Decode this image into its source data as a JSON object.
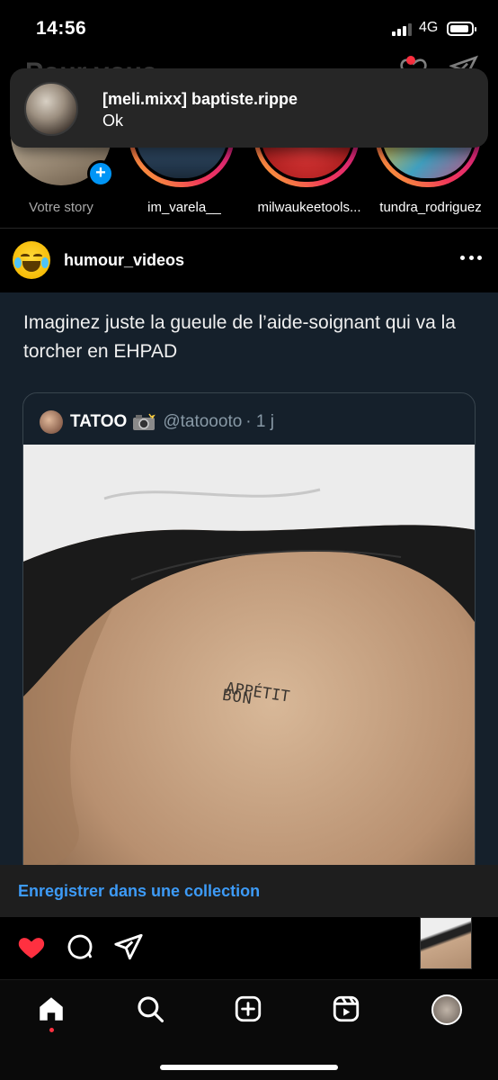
{
  "status": {
    "time": "14:56",
    "network": "4G"
  },
  "header": {
    "feed_title": "Pour vous"
  },
  "notification": {
    "title": "[meli.mixx] baptiste.rippe",
    "body": "Ok"
  },
  "stories": [
    {
      "label": "Votre story"
    },
    {
      "label": "im_varela__"
    },
    {
      "label": "milwaukeetools..."
    },
    {
      "label": "tundra_rodriguez"
    }
  ],
  "post": {
    "username": "humour_videos",
    "text": "Imaginez juste la gueule de l’aide-soignant qui va la torcher en EHPAD",
    "quote": {
      "name": "TATOO",
      "handle": "@tatoooto",
      "time": "· 1 j"
    },
    "tattoo_line1": "BON",
    "tattoo_line2": "APPÉTIT",
    "save_label": "Enregistrer dans une collection"
  },
  "colors": {
    "accent": "#3d9bf7",
    "like": "#ff3040",
    "card_bg": "#15202b"
  }
}
